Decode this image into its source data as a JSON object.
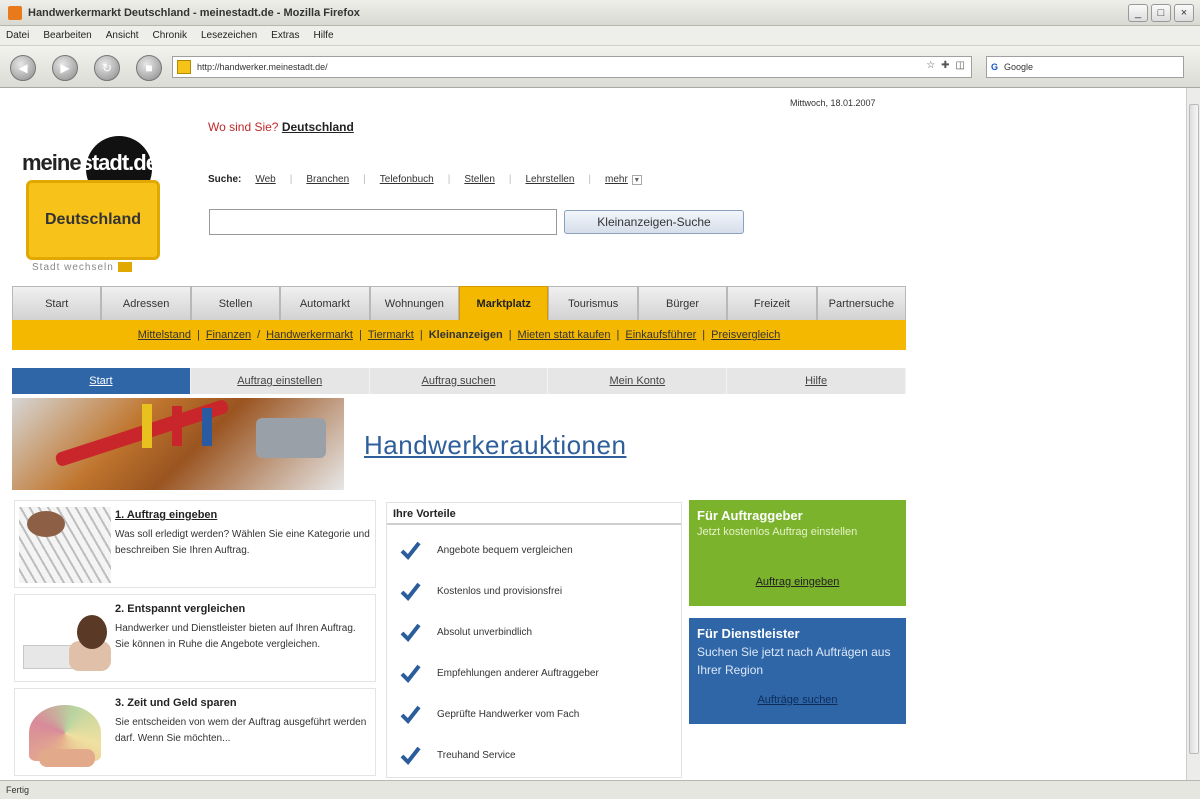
{
  "window": {
    "title": "Handwerkermarkt Deutschland - meinestadt.de - Mozilla Firefox",
    "buttons": [
      "_",
      "□",
      "×"
    ]
  },
  "menu": [
    "Datei",
    "Bearbeiten",
    "Ansicht",
    "Chronik",
    "Lesezeichen",
    "Extras",
    "Hilfe"
  ],
  "toolbar": {
    "url": "http://handwerker.meinestadt.de/",
    "url_icons": [
      "☆",
      "✚",
      "◫"
    ],
    "search_value": "Google",
    "search_icon_glyph": "G"
  },
  "status": "Fertig",
  "header": {
    "date": "Mittwoch, 18.01.2007",
    "location_label": "Wo sind Sie?",
    "location_value": "Deutschland"
  },
  "logo": {
    "word_left": "meine",
    "word_right": "stadt.de",
    "sign": "Deutschland",
    "change_city": "Stadt wechseln"
  },
  "search": {
    "label": "Suche:",
    "links": [
      "Web",
      "Branchen",
      "Telefonbuch",
      "Stellen",
      "Lehrstellen",
      "mehr"
    ],
    "input_value": "",
    "button": "Kleinanzeigen-Suche"
  },
  "main_tabs": [
    "Start",
    "Adressen",
    "Stellen",
    "Automarkt",
    "Wohnungen",
    "Marktplatz",
    "Tourismus",
    "Bürger",
    "Freizeit",
    "Partnersuche"
  ],
  "active_main_tab": "Marktplatz",
  "subnav": [
    "Mittelstand",
    "Finanzen",
    "Handwerkermarkt",
    "Tiermarkt",
    "Kleinanzeigen",
    "Mieten statt kaufen",
    "Einkaufsführer",
    "Preisvergleich"
  ],
  "sub_tabs": [
    "Start",
    "Auftrag einstellen",
    "Auftrag suchen",
    "Mein Konto",
    "Hilfe"
  ],
  "banner": {
    "heading": "Handwerkerauktionen"
  },
  "steps": [
    {
      "title": "1. Auftrag eingeben",
      "text": "Was soll erledigt werden? Wählen Sie eine Kategorie und beschreiben Sie Ihren Auftrag."
    },
    {
      "title": "2. Entspannt vergleichen",
      "text": "Handwerker und Dienstleister bieten auf Ihren Auftrag. Sie können in Ruhe die Angebote vergleichen."
    },
    {
      "title": "3. Zeit und Geld sparen",
      "text": "Sie entscheiden von wem der Auftrag ausgeführt werden darf. Wenn Sie möchten..."
    }
  ],
  "advantages": {
    "title": "Ihre Vorteile",
    "items": [
      "Angebote bequem vergleichen",
      "Kostenlos und provisionsfrei",
      "Absolut unverbindlich",
      "Empfehlungen anderer Auftraggeber",
      "Geprüfte Handwerker vom Fach",
      "Treuhand Service"
    ]
  },
  "client_box": {
    "title": "Für Auftraggeber",
    "text": "Jetzt kostenlos Auftrag einstellen",
    "link": "Auftrag eingeben"
  },
  "provider_box": {
    "title": "Für Dienstleister",
    "text": "Suchen Sie jetzt nach Aufträgen aus Ihrer Region",
    "link": "Aufträge suchen"
  },
  "colors": {
    "accent_yellow": "#f5b800",
    "green_box": "#7cb32c",
    "blue_box": "#2f66a8",
    "location_red": "#c0282a"
  }
}
